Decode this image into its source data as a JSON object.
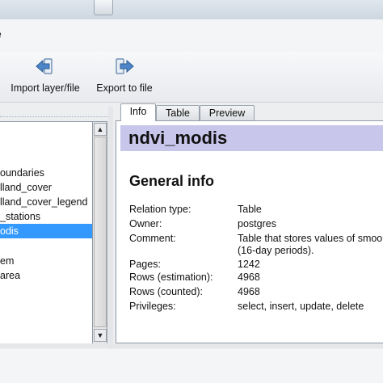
{
  "menu": {
    "item_fragment": "e"
  },
  "toolbar": {
    "import_label": "Import layer/file",
    "export_label": "Export to file",
    "import_icon": "import-arrow-icon",
    "export_icon": "export-arrow-icon"
  },
  "tree": {
    "items": [
      {
        "label": "oundaries",
        "selected": false
      },
      {
        "label": "lland_cover",
        "selected": false
      },
      {
        "label": "lland_cover_legend",
        "selected": false
      },
      {
        "label": "_stations",
        "selected": false
      },
      {
        "label": "odis",
        "selected": true
      },
      {
        "label": "em",
        "selected": false
      },
      {
        "label": "area",
        "selected": false
      }
    ],
    "selection_color": "#3399ff"
  },
  "tabs": [
    {
      "label": "Info",
      "active": true
    },
    {
      "label": "Table",
      "active": false
    },
    {
      "label": "Preview",
      "active": false
    }
  ],
  "info": {
    "table_name": "ndvi_modis",
    "section_title": "General info",
    "title_bar_color": "#c9c6ec",
    "rows": [
      {
        "key": "Relation type:",
        "value": "Table"
      },
      {
        "key": "Owner:",
        "value": "postgres"
      },
      {
        "key": "Comment:",
        "value": "Table that stores values of smoo"
      },
      {
        "key": "",
        "value": "(16-day periods)."
      },
      {
        "key": "Pages:",
        "value": "1242"
      },
      {
        "key": "Rows (estimation):",
        "value": "4968"
      },
      {
        "key": "Rows (counted):",
        "value": "4968"
      },
      {
        "key": "Privileges:",
        "value": "select, insert, update, delete"
      }
    ]
  },
  "scroll": {
    "up_arrow": "▲",
    "down_arrow": "▼"
  }
}
